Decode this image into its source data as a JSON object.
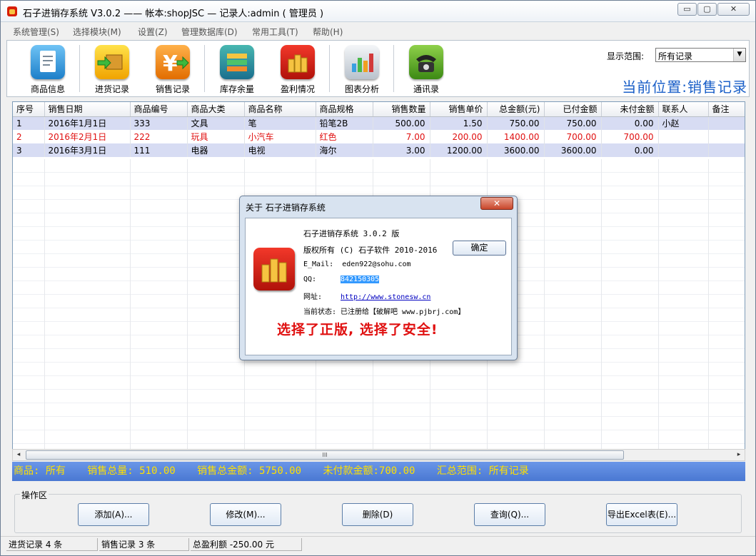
{
  "window": {
    "title": "石子进销存系统 V3.0.2 —— 帐本:shopJSC — 记录人:admin ( 管理员 )",
    "controls": [
      "▭",
      "▢",
      "✕"
    ]
  },
  "menu": [
    "系统管理(S)",
    "选择模块(M)",
    "设置(Z)",
    "管理数据库(D)",
    "常用工具(T)",
    "帮助(H)"
  ],
  "toolbar": {
    "items": [
      {
        "label": "商品信息",
        "icon": "document-icon"
      },
      {
        "label": "进货记录",
        "icon": "box-arrow-in-icon"
      },
      {
        "label": "销售记录",
        "icon": "yen-arrow-out-icon"
      },
      {
        "label": "库存余量",
        "icon": "stock-books-icon"
      },
      {
        "label": "盈利情况",
        "icon": "coins-icon"
      },
      {
        "label": "图表分析",
        "icon": "bar-chart-icon"
      },
      {
        "label": "通讯录",
        "icon": "telephone-icon"
      }
    ],
    "range_label": "显示范围:",
    "range_value": "所有记录",
    "location": "当前位置:销售记录"
  },
  "table": {
    "columns": [
      "序号",
      "销售日期",
      "商品编号",
      "商品大类",
      "商品名称",
      "商品规格",
      "销售数量",
      "销售单价",
      "总金额(元)",
      "已付金额",
      "未付金额",
      "联系人",
      "备注"
    ],
    "rows": [
      [
        "1",
        "2016年1月1日",
        "333",
        "文具",
        "笔",
        "铅笔2B",
        "500.00",
        "1.50",
        "750.00",
        "750.00",
        "0.00",
        "小赵",
        ""
      ],
      [
        "2",
        "2016年2月1日",
        "222",
        "玩具",
        "小汽车",
        "红色",
        "7.00",
        "200.00",
        "1400.00",
        "700.00",
        "700.00",
        "",
        ""
      ],
      [
        "3",
        "2016年3月1日",
        "111",
        "电器",
        "电视",
        "海尔",
        "3.00",
        "1200.00",
        "3600.00",
        "3600.00",
        "0.00",
        "",
        ""
      ]
    ]
  },
  "scrollbar": {
    "thumb_label": "III",
    "left_arrow": "◂",
    "right_arrow": "▸"
  },
  "summary": {
    "goods": "商品: 所有",
    "qty": "销售总量: 510.00",
    "amount": "销售总金额: 5750.00",
    "unpaid": "未付款金额:700.00",
    "range": "汇总范围: 所有记录"
  },
  "operations": {
    "legend": "操作区",
    "add": "添加(A)...",
    "edit": "修改(M)...",
    "delete": "删除(D)",
    "query": "查询(Q)...",
    "export": "导出Excel表(E)..."
  },
  "status": {
    "purchase": "进货记录 4 条",
    "sales": "销售记录 3 条",
    "profit": "总盈利额 -250.00 元"
  },
  "dialog": {
    "title": "关于 石子进销存系统",
    "close": "✕",
    "line1": "石子进销存系统 3.0.2 版",
    "line2": "版权所有 (C) 石子软件 2010-2016",
    "ok": "确定",
    "email_label": "E_Mail:",
    "email": "eden922@sohu.com",
    "qq_label": "QQ:",
    "qq": "842150305",
    "web_label": "网址:",
    "web": "http://www.stonesw.cn",
    "state": "当前状态: 已注册给【破解吧 www.pjbrj.com】",
    "slogan": "选择了正版, 选择了安全!"
  },
  "colors": {
    "summary_bg": "#5a86de",
    "summary_text": "#ffe000",
    "location_text": "#1a5fc8",
    "row_highlight": "#d7dcf3",
    "row_red_text": "#e01010",
    "slogan": "#e01010"
  }
}
